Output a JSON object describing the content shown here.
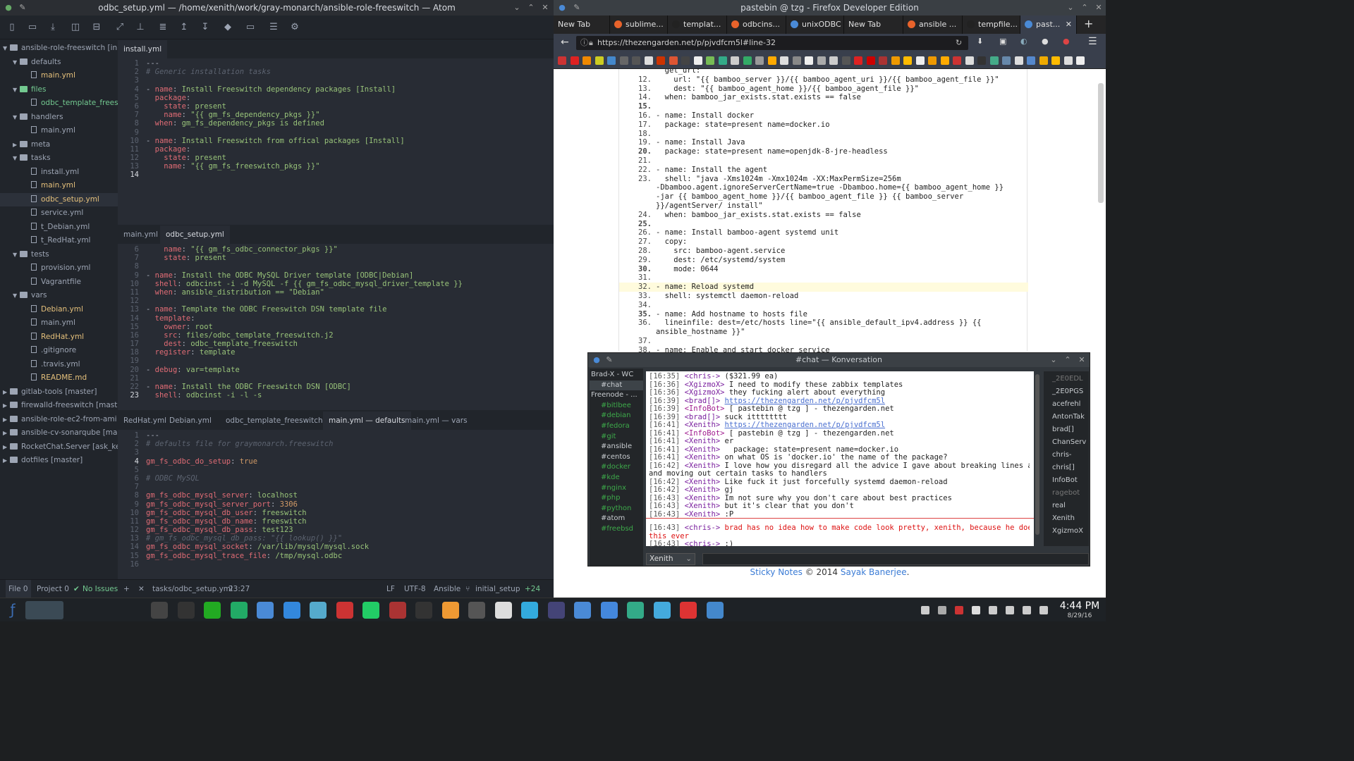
{
  "atom": {
    "title": "odbc_setup.yml — /home/xenith/work/gray-monarch/ansible-role-freeswitch — Atom",
    "tree": [
      {
        "label": "ansible-role-freeswitch [initial",
        "type": "root"
      },
      {
        "label": "defaults",
        "type": "dir"
      },
      {
        "label": "main.yml",
        "type": "file",
        "cls": "git-mod"
      },
      {
        "label": "files",
        "type": "dir",
        "cls": "git-new"
      },
      {
        "label": "odbc_template_freeswi",
        "type": "file",
        "cls": "git-new"
      },
      {
        "label": "handlers",
        "type": "dir"
      },
      {
        "label": "main.yml",
        "type": "file"
      },
      {
        "label": "meta",
        "type": "dir-closed"
      },
      {
        "label": "tasks",
        "type": "dir"
      },
      {
        "label": "install.yml",
        "type": "file"
      },
      {
        "label": "main.yml",
        "type": "file",
        "cls": "git-mod"
      },
      {
        "label": "odbc_setup.yml",
        "type": "file",
        "cls": "git-mod",
        "sel": true
      },
      {
        "label": "service.yml",
        "type": "file"
      },
      {
        "label": "t_Debian.yml",
        "type": "file"
      },
      {
        "label": "t_RedHat.yml",
        "type": "file"
      },
      {
        "label": "tests",
        "type": "dir"
      },
      {
        "label": "provision.yml",
        "type": "file"
      },
      {
        "label": "Vagrantfile",
        "type": "file"
      },
      {
        "label": "vars",
        "type": "dir"
      },
      {
        "label": "Debian.yml",
        "type": "file",
        "cls": "git-mod"
      },
      {
        "label": "main.yml",
        "type": "file"
      },
      {
        "label": "RedHat.yml",
        "type": "file",
        "cls": "git-mod"
      },
      {
        "label": ".gitignore",
        "type": "file"
      },
      {
        "label": ".travis.yml",
        "type": "file"
      },
      {
        "label": "README.md",
        "type": "file",
        "cls": "git-mod"
      },
      {
        "label": "gitlab-tools [master]",
        "type": "root-closed"
      },
      {
        "label": "firewalld-freeswitch [master]",
        "type": "root-closed"
      },
      {
        "label": "ansible-role-ec2-from-ami [ma",
        "type": "root-closed"
      },
      {
        "label": "ansible-cv-sonarqube [master]",
        "type": "root-closed"
      },
      {
        "label": "RocketChat.Server [ask_key]",
        "type": "root-closed"
      },
      {
        "label": "dotfiles [master]",
        "type": "root-closed"
      }
    ],
    "pane1": {
      "tab": "install.yml",
      "gutter": [
        "1",
        "2",
        "3",
        "4",
        "5",
        "6",
        "7",
        "8",
        "9",
        "10",
        "11",
        "12",
        "13",
        "14"
      ],
      "lines": [
        "---",
        "# Generic installation tasks",
        "",
        "- name: Install Freeswitch dependency packages [Install]",
        "  package:",
        "    state: present",
        "    name: \"{{ gm_fs_dependency_pkgs }}\"",
        "  when: gm_fs_dependency_pkgs is defined",
        "",
        "- name: Install Freeswitch from offical packages [Install]",
        "  package:",
        "    state: present",
        "    name: \"{{ gm_fs_freeswitch_pkgs }}\"",
        ""
      ]
    },
    "pane2": {
      "tabs": [
        "main.yml",
        "odbc_setup.yml"
      ],
      "gutter": [
        "6",
        "7",
        "8",
        "9",
        "10",
        "11",
        "12",
        "13",
        "14",
        "15",
        "16",
        "17",
        "18",
        "19",
        "20",
        "21",
        "22",
        "23"
      ],
      "lines": [
        "    name: \"{{ gm_fs_odbc_connector_pkgs }}\"",
        "    state: present",
        "",
        "- name: Install the ODBC MySQL Driver template [ODBC|Debian]",
        "  shell: odbcinst -i -d MySQL -f {{ gm_fs_odbc_mysql_driver_template }}",
        "  when: ansible_distribution == \"Debian\"",
        "",
        "- name: Template the ODBC Freeswitch DSN template file",
        "  template:",
        "    owner: root",
        "    src: files/odbc_template_freeswitch.j2",
        "    dest: odbc_template_freeswitch",
        "  register: template",
        "",
        "- debug: var=template",
        "",
        "- name: Install the ODBC Freeswitch DSN [ODBC]",
        "  shell: odbcinst -i -l -s"
      ]
    },
    "pane3": {
      "tabs": [
        "RedHat.yml",
        "Debian.yml",
        "odbc_template_freeswitch.j2",
        "main.yml — defaults",
        "main.yml — vars"
      ],
      "gutter": [
        "1",
        "2",
        "3",
        "4",
        "5",
        "6",
        "7",
        "8",
        "9",
        "10",
        "11",
        "12",
        "13",
        "14",
        "15",
        "16"
      ],
      "lines": [
        "---",
        "# defaults file for graymonarch.freeswitch",
        "",
        "gm_fs_odbc_do_setup: true",
        "",
        "# ODBC MySQL",
        "",
        "gm_fs_odbc_mysql_server: localhost",
        "gm_fs_odbc_mysql_server_port: 3306",
        "gm_fs_odbc_mysql_db_user: freeswitch",
        "gm_fs_odbc_mysql_db_name: freeswitch",
        "gm_fs_odbc_mysql_db_pass: test123",
        "# gm_fs_odbc_mysql_db_pass: \"{{ lookup() }}\"",
        "gm_fs_odbc_mysql_socket: /var/lib/mysql/mysql.sock",
        "gm_fs_odbc_mysql_trace_file: /tmp/mysql.odbc",
        ""
      ]
    },
    "status": {
      "file": "File 0",
      "project": "Project 0",
      "issues": "No Issues",
      "path": "tasks/odbc_setup.yml",
      "cursor": "23:27",
      "eol": "LF",
      "encoding": "UTF-8",
      "grammar": "Ansible",
      "branch": "initial_setup",
      "diff": "+24"
    }
  },
  "firefox": {
    "title": "pastebin @ tzg - Firefox Developer Edition",
    "tabs": [
      "New Tab",
      "sublime...",
      "templat...",
      "odbcins...",
      "unixODBC",
      "New Tab",
      "ansible ...",
      "tempfile...",
      "past..."
    ],
    "url": "https://thezengarden.net/p/pjvdfcm5l#line-32",
    "paste_lines": [
      {
        "n": "",
        "t": "  get_url:"
      },
      {
        "n": "12.",
        "t": "    url: \"{{ bamboo_server }}/{{ bamboo_agent_uri }}/{{ bamboo_agent_file }}\""
      },
      {
        "n": "13.",
        "t": "    dest: \"{{ bamboo_agent_home }}/{{ bamboo_agent_file }}\""
      },
      {
        "n": "14.",
        "t": "  when: bamboo_jar_exists.stat.exists == false"
      },
      {
        "n": "15.",
        "t": "",
        "b": true
      },
      {
        "n": "16.",
        "t": "- name: Install docker"
      },
      {
        "n": "17.",
        "t": "  package: state=present name=docker.io"
      },
      {
        "n": "18.",
        "t": ""
      },
      {
        "n": "19.",
        "t": "- name: Install Java"
      },
      {
        "n": "20.",
        "t": "  package: state=present name=openjdk-8-jre-headless",
        "b": true
      },
      {
        "n": "21.",
        "t": ""
      },
      {
        "n": "22.",
        "t": "- name: Install the agent"
      },
      {
        "n": "23.",
        "t": "  shell: \"java -Xms1024m -Xmx1024m -XX:MaxPermSize=256m"
      },
      {
        "n": "",
        "t": "-Dbamboo.agent.ignoreServerCertName=true -Dbamboo.home={{ bamboo_agent_home }}"
      },
      {
        "n": "",
        "t": "-jar {{ bamboo_agent_home }}/{{ bamboo_agent_file }} {{ bamboo_server"
      },
      {
        "n": "",
        "t": "}}/agentServer/ install\""
      },
      {
        "n": "24.",
        "t": "  when: bamboo_jar_exists.stat.exists == false"
      },
      {
        "n": "25.",
        "t": "",
        "b": true
      },
      {
        "n": "26.",
        "t": "- name: Install bamboo-agent systemd unit"
      },
      {
        "n": "27.",
        "t": "  copy:"
      },
      {
        "n": "28.",
        "t": "    src: bamboo-agent.service"
      },
      {
        "n": "29.",
        "t": "    dest: /etc/systemd/system"
      },
      {
        "n": "30.",
        "t": "    mode: 0644",
        "b": true
      },
      {
        "n": "31.",
        "t": ""
      },
      {
        "n": "32.",
        "t": "- name: Reload systemd",
        "hl": true
      },
      {
        "n": "33.",
        "t": "  shell: systemctl daemon-reload"
      },
      {
        "n": "34.",
        "t": ""
      },
      {
        "n": "35.",
        "t": "- name: Add hostname to hosts file",
        "b": true
      },
      {
        "n": "36.",
        "t": "  lineinfile: dest=/etc/hosts line=\"{{ ansible_default_ipv4.address }} {{"
      },
      {
        "n": "",
        "t": "ansible_hostname }}\""
      },
      {
        "n": "37.",
        "t": ""
      },
      {
        "n": "38.",
        "t": "- name: Enable and start docker service"
      }
    ],
    "footer_link1": "Sticky Notes",
    "footer_mid": " © 2014 ",
    "footer_link2": "Sayak Banerjee",
    "footer_end": "."
  },
  "konversation": {
    "title": "#chat — Konversation",
    "sidebar": [
      {
        "label": "Brad-X - WC",
        "cls": ""
      },
      {
        "label": "#chat",
        "cls": "sel"
      },
      {
        "label": "Freenode - ...",
        "cls": ""
      },
      {
        "label": "#bitlbee",
        "cls": "grn"
      },
      {
        "label": "#debian",
        "cls": "grn"
      },
      {
        "label": "#fedora",
        "cls": "grn"
      },
      {
        "label": "#git",
        "cls": "grn"
      },
      {
        "label": "#ansible",
        "cls": ""
      },
      {
        "label": "#centos",
        "cls": ""
      },
      {
        "label": "#docker",
        "cls": "grn"
      },
      {
        "label": "#kde",
        "cls": "grn"
      },
      {
        "label": "#nginx",
        "cls": "grn"
      },
      {
        "label": "#php",
        "cls": "grn"
      },
      {
        "label": "#python",
        "cls": "grn"
      },
      {
        "label": "#atom",
        "cls": ""
      },
      {
        "label": "#freebsd",
        "cls": "grn"
      }
    ],
    "chat": [
      {
        "ts": "[16:35]",
        "nick": "<chris->",
        "msg": " ($321.99 ea)"
      },
      {
        "ts": "[16:36]",
        "nick": "<XgizmoX>",
        "msg": " I need to modify these zabbix templates"
      },
      {
        "ts": "[16:36]",
        "nick": "<XgizmoX>",
        "msg": " they fucking alert about everything"
      },
      {
        "ts": "[16:39]",
        "nick": "<brad[]>",
        "msg": " ",
        "link": "https://thezengarden.net/p/pjvdfcm5l"
      },
      {
        "ts": "[16:39]",
        "nick": "<InfoBot>",
        "msg": " [ pastebin @ tzg ] - thezengarden.net"
      },
      {
        "ts": "[16:39]",
        "nick": "<brad[]>",
        "msg": " suck itttttttt"
      },
      {
        "ts": "[16:41]",
        "nick": "<Xenith>",
        "msg": " ",
        "link": "https://thezengarden.net/p/pjvdfcm5l"
      },
      {
        "ts": "[16:41]",
        "nick": "<InfoBot>",
        "msg": " [ pastebin @ tzg ] - thezengarden.net"
      },
      {
        "ts": "[16:41]",
        "nick": "<Xenith>",
        "msg": " er"
      },
      {
        "ts": "[16:41]",
        "nick": "<Xenith>",
        "msg": "   package: state=present name=docker.io"
      },
      {
        "ts": "[16:41]",
        "nick": "<Xenith>",
        "msg": " on what OS is 'docker.io' the name of the package?"
      },
      {
        "ts": "[16:42]",
        "nick": "<Xenith>",
        "msg": " I love how you disregard all the advice I gave about breaking lines apart"
      },
      {
        "ts": "",
        "nick": "",
        "msg": "and moving out certain tasks to handlers"
      },
      {
        "ts": "[16:42]",
        "nick": "<Xenith>",
        "msg": " Like fuck it just forcefully systemd daemon-reload"
      },
      {
        "ts": "[16:42]",
        "nick": "<Xenith>",
        "msg": " gj"
      },
      {
        "ts": "[16:43]",
        "nick": "<Xenith>",
        "msg": " Im not sure why you don't care about best practices"
      },
      {
        "ts": "[16:43]",
        "nick": "<Xenith>",
        "msg": " but it's clear that you don't"
      },
      {
        "ts": "[16:43]",
        "nick": "<Xenith>",
        "msg": " :P"
      },
      {
        "ts": "[16:43]",
        "nick": "<chris->",
        "msg": " brad has no idea how to make code look pretty, xenith, because he doesnt do",
        "red": true
      },
      {
        "ts": "",
        "nick": "",
        "msg": "this ever",
        "red": true
      },
      {
        "ts": "[16:43]",
        "nick": "<chris->",
        "msg": " :)"
      }
    ],
    "nicks": [
      {
        "label": "_2E0EDL",
        "grey": true
      },
      {
        "label": "_2E0PGS",
        "grey": false
      },
      {
        "label": "acefrehl",
        "grey": false
      },
      {
        "label": "AntonTak",
        "grey": false
      },
      {
        "label": "brad[]",
        "grey": false
      },
      {
        "label": "ChanServ",
        "grey": false
      },
      {
        "label": "chris-",
        "grey": false
      },
      {
        "label": "chris[]",
        "grey": false
      },
      {
        "label": "InfoBot",
        "grey": false
      },
      {
        "label": "ragebot",
        "grey": true
      },
      {
        "label": "real",
        "grey": false
      },
      {
        "label": "Xenith",
        "grey": false
      },
      {
        "label": "XgizmoX",
        "grey": false
      }
    ],
    "nick_select": "Xenith"
  },
  "taskbar": {
    "time": "4:44 PM",
    "date": "8/29/16"
  }
}
